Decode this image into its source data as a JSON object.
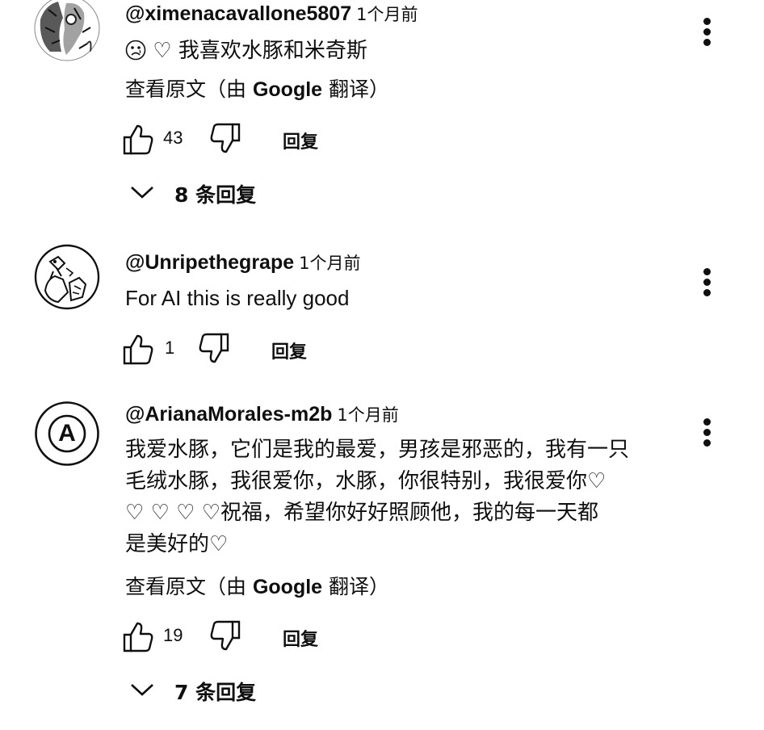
{
  "comments": [
    {
      "author": "@ximenacavallone5807",
      "time": "1个月前",
      "text": "我喜欢水豚和米奇斯",
      "translate_label_prefix": "查看原文（由 ",
      "translate_label_brand": "Google",
      "translate_label_suffix": " 翻译）",
      "likes": "43",
      "reply_label": "回复",
      "replies_label": "8 条回复",
      "avatar_icon": "photo-avatar-icon"
    },
    {
      "author": "@Unripethegrape",
      "time": "1个月前",
      "text": "For AI this is really good",
      "likes": "1",
      "reply_label": "回复",
      "avatar_icon": "drawing-avatar-icon"
    },
    {
      "author": "@ArianaMorales-m2b",
      "time": "1个月前",
      "avatar_letter": "A",
      "text_line1": "我爱水豚，它们是我的最爱，男孩是邪恶的，我有一只",
      "text_line2": "毛绒水豚，我很爱你，水豚，你很特别，我很爱你",
      "text_line3": "祝福，希望你好好照顾他，我的每一天都",
      "text_line4": "是美好的",
      "translate_label_prefix": "查看原文（由 ",
      "translate_label_brand": "Google",
      "translate_label_suffix": " 翻译）",
      "likes": "19",
      "reply_label": "回复",
      "replies_label": "7 条回复"
    }
  ],
  "icons": {
    "like": "thumb-up-icon",
    "dislike": "thumb-down-icon",
    "more": "more-vert-icon",
    "chevron": "chevron-down-icon",
    "heart": "heart-outline-icon",
    "sad": "sad-face-emoji"
  },
  "glyphs": {
    "heart": "♡"
  },
  "colors": {
    "text": "#0f0f0f",
    "background": "#ffffff"
  }
}
